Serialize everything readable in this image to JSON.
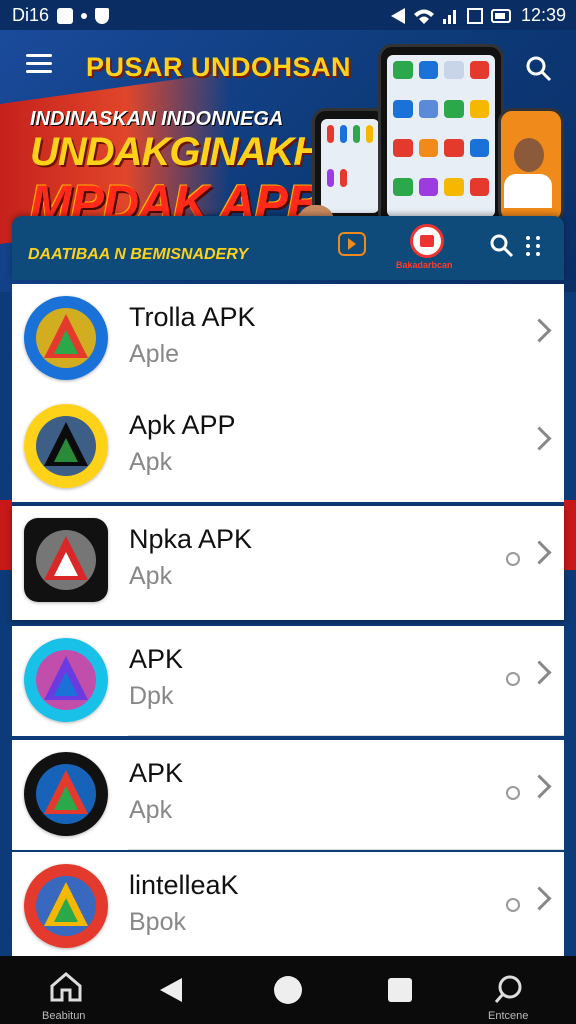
{
  "status_bar": {
    "left_text": "Di16",
    "time": "12:39"
  },
  "header": {
    "title": "PUSAR UNDOHSAN"
  },
  "banner": {
    "line1": "INDINASKAN INDONNEGA",
    "line2": "UNDAKGINAKHAN",
    "line3": "MPDAK APB",
    "subtitle": "DAATIBAA N BEMISNADERY",
    "badge_label": "Bakadarbcan"
  },
  "apps": [
    {
      "title": "Trolla APK",
      "subtitle": "Aple",
      "colors": [
        "#1a72d8",
        "#e43a2e",
        "#2aa84a",
        "#f5b700"
      ]
    },
    {
      "title": "Apk APP",
      "subtitle": "Apk",
      "colors": [
        "#ffd21a",
        "#0b0b0b",
        "#2a8a3a",
        "#1a4a9b"
      ]
    },
    {
      "title": "Npka APK",
      "subtitle": "Apk",
      "colors": [
        "#111111",
        "#d92626",
        "#ffffff",
        "#888888"
      ]
    },
    {
      "title": "APK",
      "subtitle": "Dpk",
      "colors": [
        "#19c0e8",
        "#6a3be0",
        "#1a72d8",
        "#e03aa0"
      ]
    },
    {
      "title": "APK",
      "subtitle": "Apk",
      "colors": [
        "#111111",
        "#e43a2e",
        "#2aa84a",
        "#1a72d8"
      ]
    },
    {
      "title": "lintelleaK",
      "subtitle": "Bpok",
      "colors": [
        "#e43a2e",
        "#f5b700",
        "#2aa84a",
        "#1a72d8"
      ]
    }
  ],
  "navbar": {
    "home_label": "Beabitun",
    "search_label": "Entcene"
  }
}
